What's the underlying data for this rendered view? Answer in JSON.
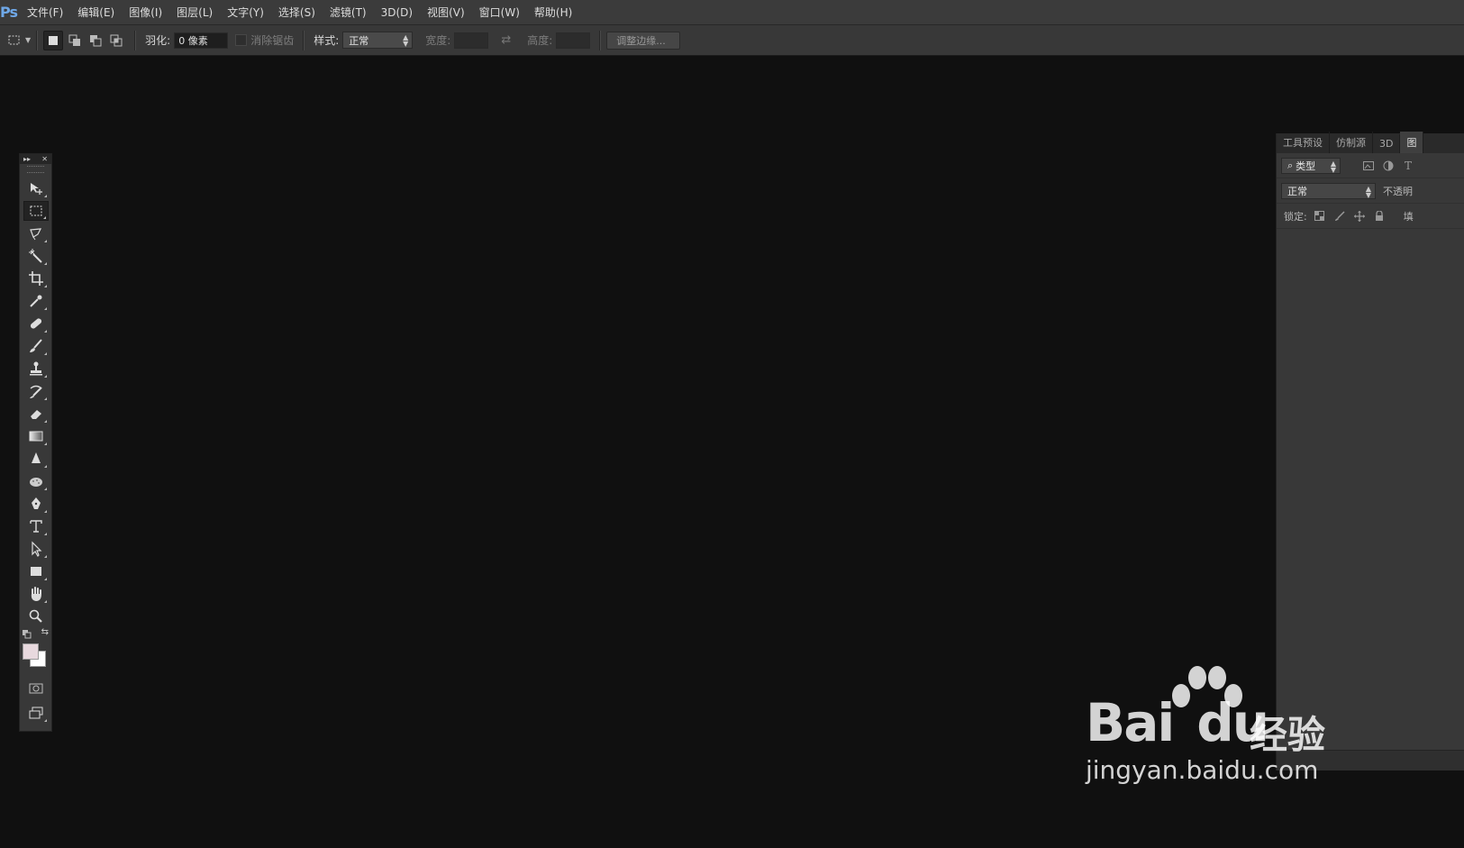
{
  "app": {
    "logo": "Ps"
  },
  "menu": [
    "文件(F)",
    "编辑(E)",
    "图像(I)",
    "图层(L)",
    "文字(Y)",
    "选择(S)",
    "滤镜(T)",
    "3D(D)",
    "视图(V)",
    "窗口(W)",
    "帮助(H)"
  ],
  "options": {
    "feather_label": "羽化:",
    "feather_value": "0 像素",
    "antialias_label": "消除锯齿",
    "style_label": "样式:",
    "style_value": "正常",
    "width_label": "宽度:",
    "height_label": "高度:",
    "refine_edge_label": "调整边缘..."
  },
  "tools": [
    "move",
    "marquee",
    "lasso",
    "magic-wand",
    "crop",
    "eyedropper",
    "healing",
    "brush",
    "stamp",
    "history-brush",
    "eraser",
    "gradient",
    "blur",
    "dodge",
    "pen",
    "type",
    "path-select",
    "rectangle",
    "hand",
    "zoom"
  ],
  "colors": {
    "foreground": "#e8d9de",
    "background": "#ffffff"
  },
  "panel": {
    "tabs": [
      "工具预设",
      "仿制源",
      "3D",
      "图"
    ],
    "filter_label": "类型",
    "blend_mode": "正常",
    "opacity_label": "不透明",
    "lock_label": "锁定:",
    "fill_label": "填"
  },
  "watermark": {
    "brand": "Bai",
    "brand2": "du",
    "cn": "经验",
    "url": "jingyan.baidu.com"
  }
}
